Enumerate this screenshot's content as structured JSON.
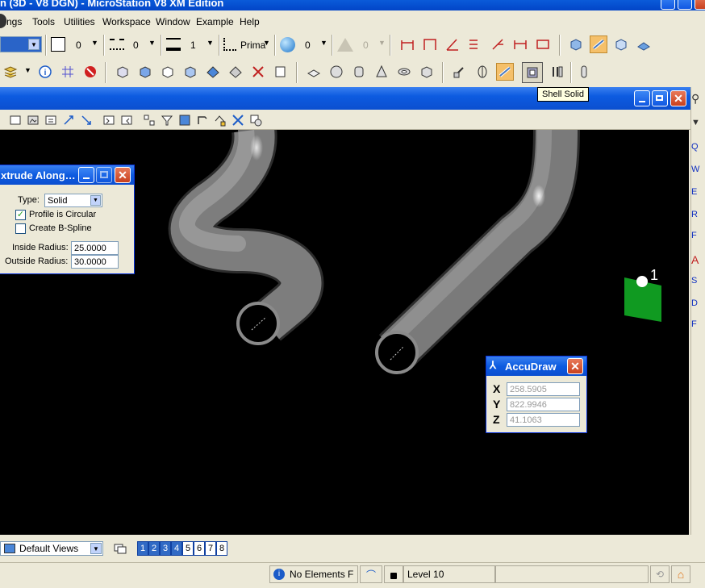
{
  "app": {
    "title_fragment": "n (3D - V8 DGN) - MicroStation V8 XM Edition"
  },
  "menu": {
    "items": [
      "ngs",
      "Tools",
      "Utilities",
      "Workspace",
      "Window",
      "Example",
      "Help"
    ]
  },
  "attributes_toolbar": {
    "color_value": "0",
    "style_value": "0",
    "weight_value": "1",
    "class_value": "Prima",
    "transparency_value": "0",
    "priority_value": "0"
  },
  "tooltip": {
    "text": "Shell Solid"
  },
  "extrude_dialog": {
    "title": "xtrude Along…",
    "type_label": "Type:",
    "type_value": "Solid",
    "profile_circular_label": "Profile is Circular",
    "profile_circular_checked": true,
    "create_bspline_label": "Create B-Spline",
    "create_bspline_checked": false,
    "inside_radius_label": "Inside Radius:",
    "inside_radius_value": "25.0000",
    "outside_radius_label": "Outside Radius:",
    "outside_radius_value": "30.0000"
  },
  "accudraw": {
    "title": "AccuDraw",
    "x_label": "X",
    "x_value": "258.5905",
    "y_label": "Y",
    "y_value": "822.9946",
    "z_label": "Z",
    "z_value": "41.1063"
  },
  "viewport": {
    "marker_label": "1"
  },
  "right_panel": {
    "items": [
      "Q",
      "W",
      "E",
      "R",
      "F",
      "A",
      "S",
      "D",
      "F"
    ]
  },
  "bottom": {
    "saved_views_value": "Default Views",
    "view_buttons": [
      "1",
      "2",
      "3",
      "4",
      "5",
      "6",
      "7",
      "8"
    ],
    "active_views": [
      "1",
      "2",
      "3",
      "4"
    ]
  },
  "status": {
    "message": "No Elements F",
    "level": "Level 10"
  },
  "colors": {
    "xp_blue": "#0b4fd0",
    "dialog_bg": "#ece9d8",
    "viewport_bg": "#000000",
    "green_marker": "#109a21"
  }
}
